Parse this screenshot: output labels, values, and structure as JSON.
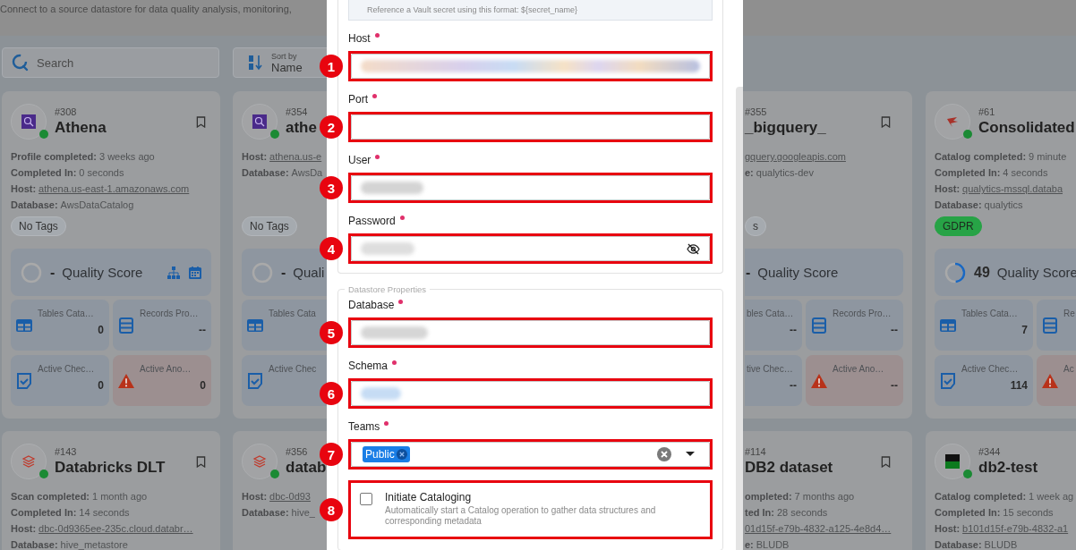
{
  "panes": [
    {
      "subtitle": "Connect to a source datastore for data quality analysis, monitoring,",
      "toolbar": {
        "search_placeholder": "Search",
        "sort_label": "Sort by",
        "sort_value": "Name"
      },
      "cards": [
        {
          "kind": "full",
          "number": "#308",
          "name": "Athena",
          "logo": {
            "kind": "athena"
          },
          "meta": [
            {
              "label": "Profile completed:",
              "value": "3 weeks ago",
              "link": false
            },
            {
              "label": "Completed In:",
              "value": "0 seconds",
              "link": false
            },
            {
              "label": "Host:",
              "value": "athena.us-east-1.amazonaws.com",
              "link": true
            },
            {
              "label": "Database:",
              "value": "AwsDataCatalog",
              "link": false
            }
          ],
          "tag": {
            "kind": "empty",
            "text": "No Tags"
          },
          "score": {
            "value": "-",
            "label": "Quality Score",
            "level": 0,
            "shortcuts": true
          },
          "tiles": [
            [
              {
                "kind": "tables",
                "label": "Tables Cata…",
                "value": "0"
              },
              {
                "kind": "records",
                "label": "Records Pro…",
                "value": "--"
              }
            ],
            [
              {
                "kind": "checks",
                "label": "Active Chec…",
                "value": "0"
              },
              {
                "kind": "anomalies",
                "label": "Active Ano…",
                "value": "0"
              }
            ]
          ]
        },
        {
          "kind": "cut-right",
          "number": "#354",
          "name": "athe",
          "logo": {
            "kind": "athena"
          },
          "meta": [
            {
              "label": "Host:",
              "value": "athena.us-e",
              "link": true
            },
            {
              "label": "Database:",
              "value": "AwsDa",
              "link": false
            }
          ],
          "tag": {
            "kind": "empty",
            "text": "No Tags"
          },
          "score": {
            "value": "-",
            "label": "Quali",
            "level": 0
          },
          "tiles": [
            [
              {
                "kind": "tables",
                "label": "Tables Cata"
              }
            ],
            [
              {
                "kind": "checks",
                "label": "Active Chec"
              }
            ]
          ]
        },
        {
          "kind": "full",
          "number": "#143",
          "name": "Databricks DLT",
          "logo": {
            "kind": "databricks"
          },
          "meta": [
            {
              "label": "Scan completed:",
              "value": "1 month ago",
              "link": false
            },
            {
              "label": "Completed In:",
              "value": "14 seconds",
              "link": false
            },
            {
              "label": "Host:",
              "value": "dbc-0d9365ee-235c.cloud.databr…",
              "link": true
            },
            {
              "label": "Database:",
              "value": "hive_metastore",
              "link": false
            }
          ]
        },
        {
          "kind": "cut-right",
          "number": "#356",
          "name": "datab",
          "logo": {
            "kind": "databricks"
          },
          "meta": [
            {
              "label": "Host:",
              "value": "dbc-0d93",
              "link": true
            },
            {
              "label": "Database:",
              "value": "hive_",
              "link": false
            }
          ]
        }
      ]
    },
    {
      "cards": [
        {
          "kind": "cut-left",
          "number": "#355",
          "name": "_bigquery_",
          "meta": [
            {
              "value": "gquery.googleapis.com",
              "link": true
            },
            {
              "label": "e:",
              "value": "qualytics-dev",
              "link": false
            }
          ],
          "tag": {
            "kind": "empty",
            "text": "s"
          },
          "score": {
            "value": "-",
            "label": "Quality Score"
          },
          "tiles": [
            [
              {
                "kind": "cut",
                "label": "bles Cata…",
                "value": "--"
              },
              {
                "kind": "records",
                "label": "Records Pro…",
                "value": "--"
              }
            ],
            [
              {
                "kind": "cut",
                "label": "tive Chec…",
                "value": "--"
              },
              {
                "kind": "anomalies",
                "label": "Active Ano…",
                "value": "--"
              }
            ]
          ]
        },
        {
          "kind": "cut-right",
          "number": "#61",
          "name": "Consolidated",
          "logo": {
            "kind": "mssql"
          },
          "meta": [
            {
              "label": "Catalog completed:",
              "value": "9 minute",
              "link": false
            },
            {
              "label": "Completed In:",
              "value": "4 seconds",
              "link": false
            },
            {
              "label": "Host:",
              "value": "qualytics-mssql.databa",
              "link": true
            },
            {
              "label": "Database:",
              "value": "qualytics",
              "link": false
            }
          ],
          "tag": {
            "kind": "tag",
            "text": "GDPR"
          },
          "score": {
            "value": "49",
            "label": "Quality Score",
            "level": 0.49
          },
          "tiles": [
            [
              {
                "kind": "tables",
                "label": "Tables Cata…",
                "value": "7"
              },
              {
                "kind": "records",
                "label": "Re"
              }
            ],
            [
              {
                "kind": "checks",
                "label": "Active Chec…",
                "value": "114"
              },
              {
                "kind": "anomalies",
                "label": "Ac"
              }
            ]
          ]
        },
        {
          "kind": "cut-left",
          "number": "#114",
          "name": "DB2 dataset",
          "meta": [
            {
              "label": "ompleted:",
              "value": "7 months ago",
              "link": false
            },
            {
              "label": "ted In:",
              "value": "28 seconds",
              "link": false
            },
            {
              "value": "01d15f-e79b-4832-a125-4e8d4…",
              "link": true
            },
            {
              "label": "e:",
              "value": "BLUDB",
              "link": false
            }
          ]
        },
        {
          "kind": "cut-right",
          "number": "#344",
          "name": "db2-test",
          "logo": {
            "kind": "db2"
          },
          "meta": [
            {
              "label": "Catalog completed:",
              "value": "1 week ag",
              "link": false
            },
            {
              "label": "Completed In:",
              "value": "15 seconds",
              "link": false
            },
            {
              "label": "Host:",
              "value": "b101d15f-e79b-4832-a1",
              "link": true
            },
            {
              "label": "Database:",
              "value": "BLUDB",
              "link": false
            }
          ]
        }
      ]
    }
  ],
  "modal": {
    "vault_hint": "Reference a Vault secret using this format: ${secret_name}",
    "connection_fields": [
      {
        "label": "Host",
        "kind": "text",
        "redacted": true,
        "marker": "1"
      },
      {
        "label": "Port",
        "kind": "text",
        "redacted": false,
        "marker": "2"
      },
      {
        "label": "User",
        "kind": "text",
        "redacted": true,
        "marker": "3"
      },
      {
        "label": "Password",
        "kind": "password",
        "redacted": true,
        "marker": "4"
      }
    ],
    "properties_title": "Datastore Properties",
    "property_fields": [
      {
        "label": "Database",
        "kind": "text",
        "redacted": true,
        "marker": "5"
      },
      {
        "label": "Schema",
        "kind": "text",
        "redacted": true,
        "marker": "6"
      },
      {
        "label": "Teams",
        "kind": "select",
        "chips": [
          "Public"
        ],
        "marker": "7"
      }
    ],
    "cataloging": {
      "label": "Initiate Cataloging",
      "description": "Automatically start a Catalog operation to gather data structures and corresponding metadata",
      "checked": false,
      "marker": "8"
    }
  }
}
